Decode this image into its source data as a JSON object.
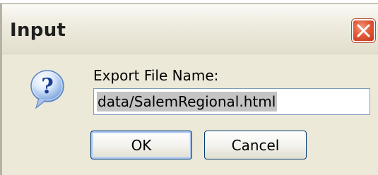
{
  "dialog": {
    "title": "Input",
    "close_icon": "close-x-icon",
    "icon": "question-icon",
    "prompt_label": "Export File Name:",
    "filename_value": "data/SalemRegional.html",
    "ok_label": "OK",
    "cancel_label": "Cancel"
  },
  "colors": {
    "dialog_bg": "#ece9d8",
    "close_button": "#e25b3a",
    "button_border": "#003c74",
    "focus_ring": "#a9c4f0",
    "selection": "#c4c4c4"
  }
}
